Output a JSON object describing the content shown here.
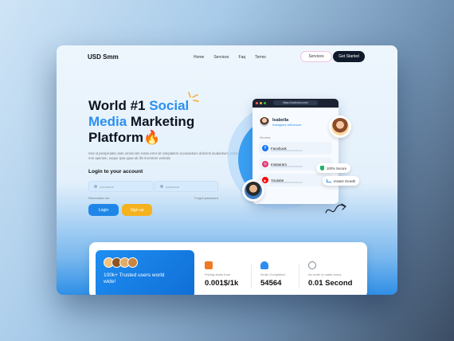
{
  "header": {
    "logo": "USD Smm",
    "nav": [
      "Home",
      "Services",
      "Faq",
      "Terms"
    ],
    "services_button": "Services",
    "get_started_button": "Get Started"
  },
  "hero": {
    "title_part1": "World #1 ",
    "title_part2": "Social Media",
    "title_part3": " Marketing Platform",
    "title_emoji": "🔥",
    "description": "Sed ut perspiciatis unde omnis iste natus error sit voluptatem accusantium dolorem laudantium, totam rem aperiam, eaque ipsa quae ab illo inventore veritatis",
    "login_label": "Login to your account",
    "username_placeholder": "username",
    "password_placeholder": "password",
    "remember_me": "Remember me",
    "forgot_password": "Forgot password",
    "login_button": "Login",
    "signup_button": "Sign up"
  },
  "illustration": {
    "url": "https://usdsmm.com/",
    "profile_name": "Isabella",
    "profile_role": "Instagram Influencer",
    "services_label": "Services",
    "services": [
      {
        "name": "Facebook",
        "color": "#1877f2",
        "glyph": "f"
      },
      {
        "name": "Instagram",
        "color": "#e1306c",
        "glyph": "◎"
      },
      {
        "name": "Youtube",
        "color": "#ff0000",
        "glyph": "▶"
      }
    ],
    "badge_secure": "100% Secure",
    "badge_growth": "Instant Growth"
  },
  "stats": {
    "trusted_text": "100k+ Trusted users world wide!",
    "items": [
      {
        "label": "Pricing starts from",
        "value": "0.001$/1k",
        "icon_color": "#f07a24"
      },
      {
        "label": "Order Completed",
        "value": "54564",
        "icon_color": "#2b8ff0"
      },
      {
        "label": "An order is made every",
        "value": "0.01 Second",
        "icon_color": "#7a8794"
      }
    ]
  },
  "colors": {
    "accent_blue": "#2b8ff0",
    "signup_yellow": "#f5b21f",
    "dark": "#0f1b2b"
  }
}
